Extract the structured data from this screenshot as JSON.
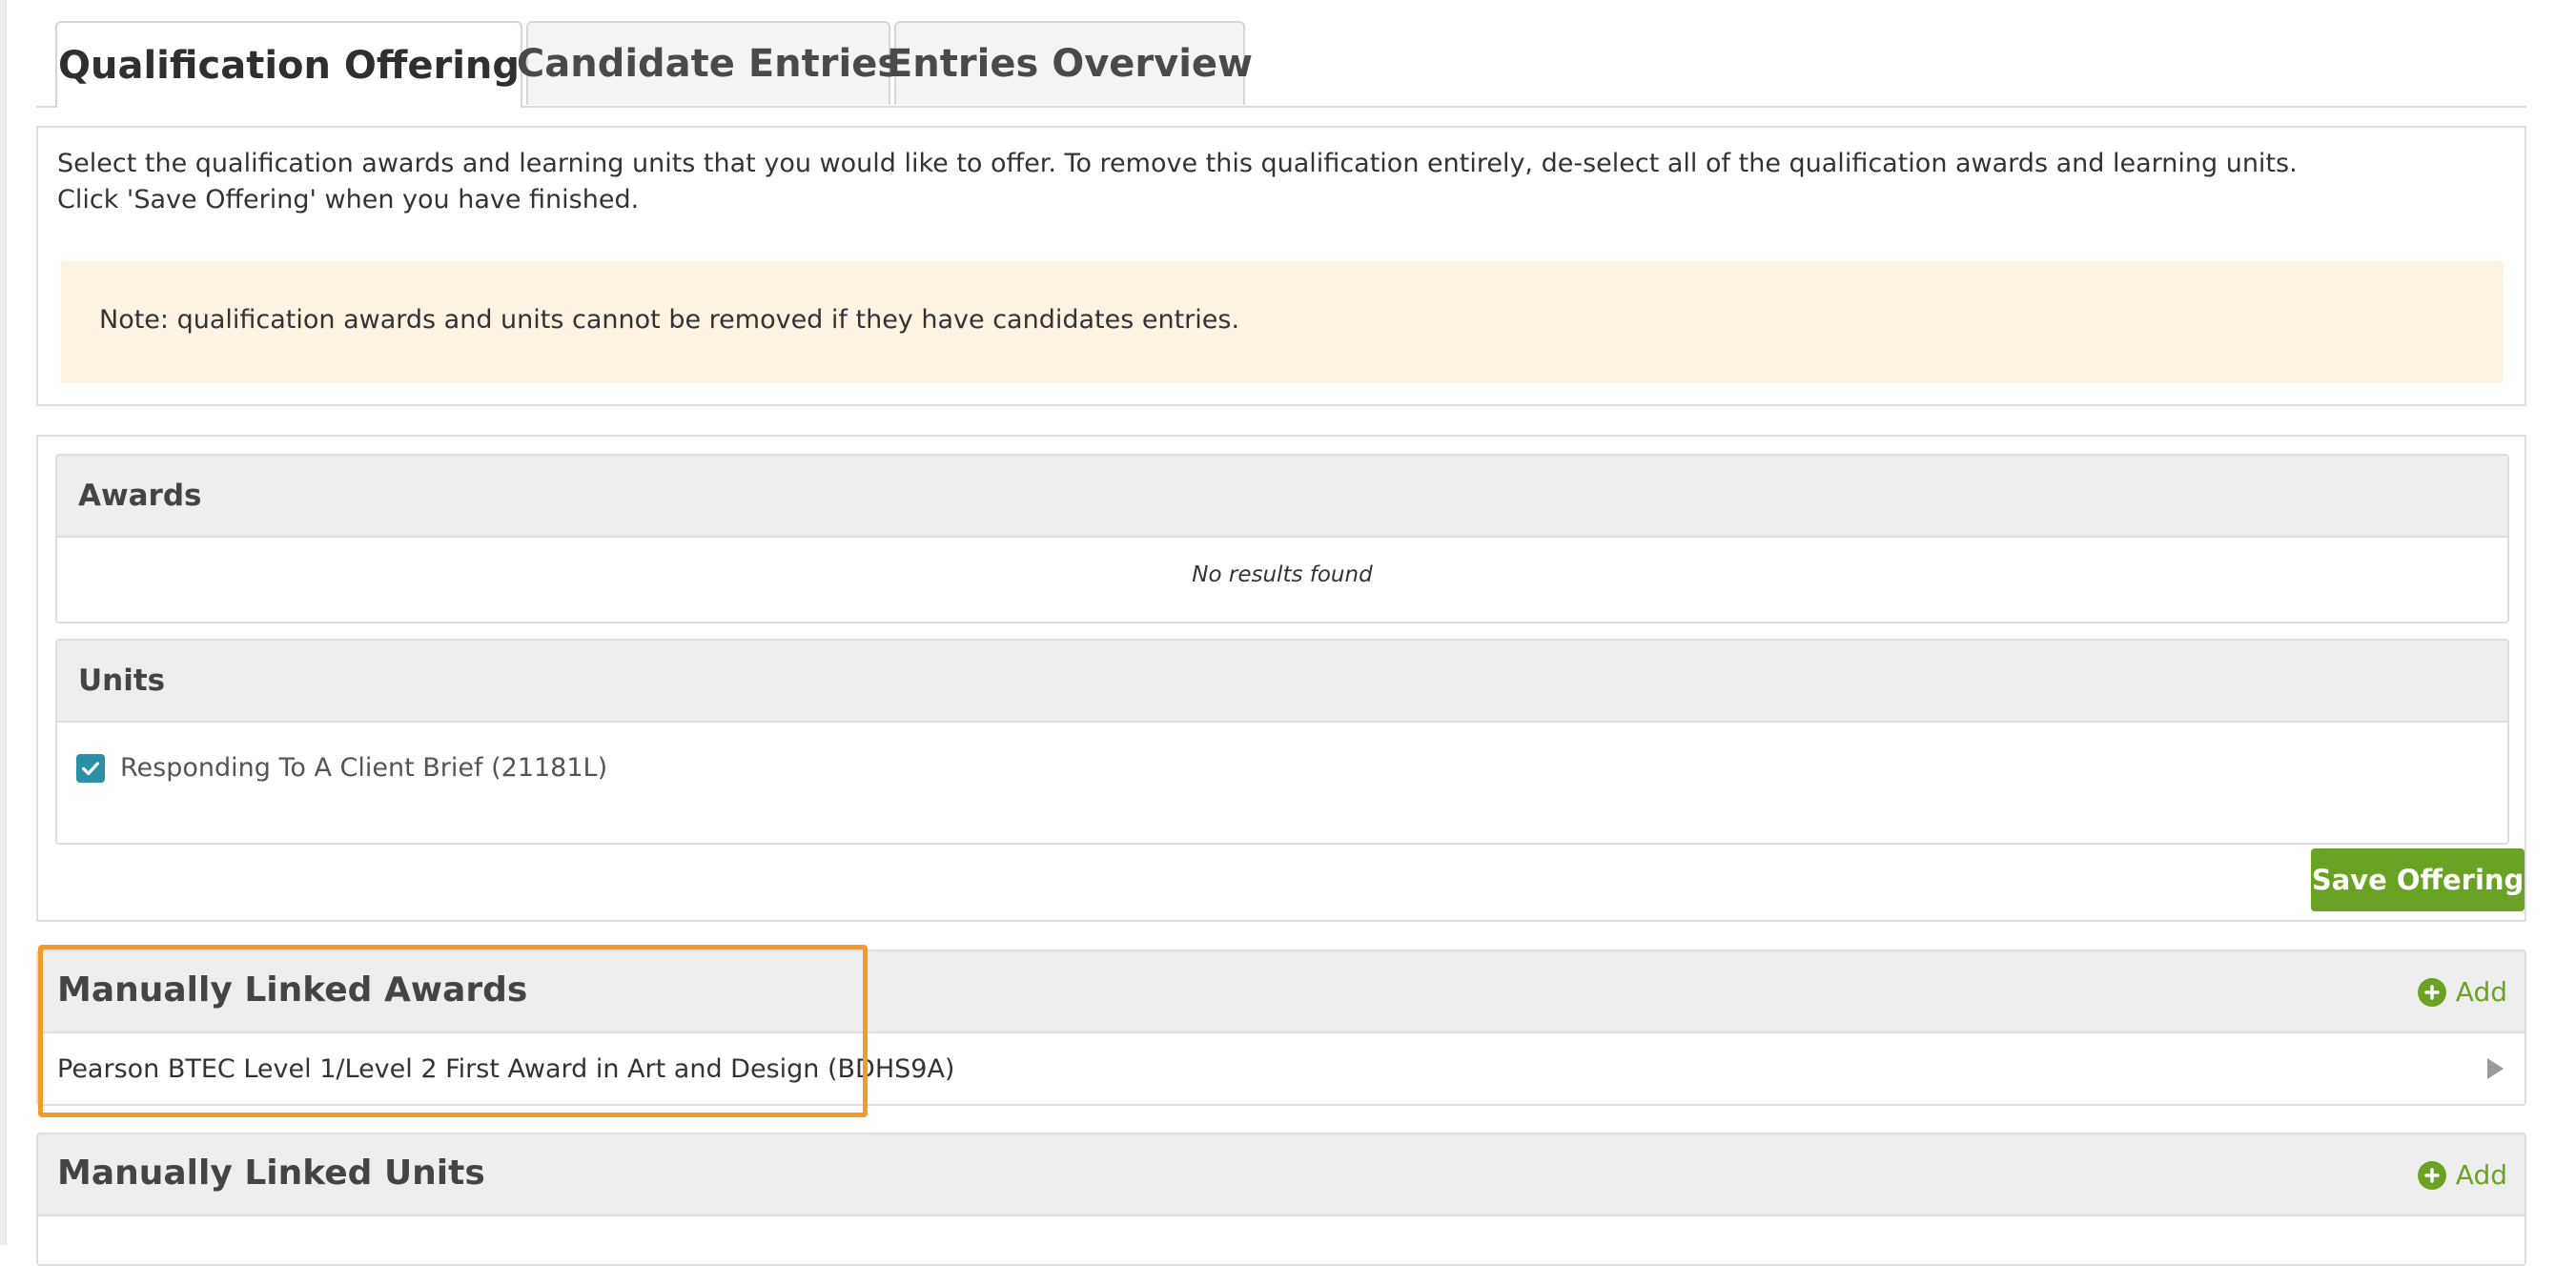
{
  "tabs": [
    {
      "label": "Qualification Offering",
      "active": true
    },
    {
      "label": "Candidate Entries",
      "active": false
    },
    {
      "label": "Entries Overview",
      "active": false
    }
  ],
  "intro": {
    "line1": "Select the qualification awards and learning units that you would like to offer. To remove this qualification entirely, de-select all of the qualification awards and learning units.",
    "line2": "Click 'Save Offering' when you have finished.",
    "note": "Note: qualification awards and units cannot be removed if they have candidates entries."
  },
  "awards_panel": {
    "title": "Awards",
    "empty_text": "No results found"
  },
  "units_panel": {
    "title": "Units",
    "items": [
      {
        "label": "Responding To A Client Brief (21181L)",
        "checked": true
      }
    ]
  },
  "save_button": "Save Offering",
  "manual_awards": {
    "title": "Manually Linked Awards",
    "add_label": "Add",
    "items": [
      {
        "label": "Pearson BTEC Level 1/Level 2 First Award in Art and Design (BDHS9A)"
      }
    ]
  },
  "manual_units": {
    "title": "Manually Linked Units",
    "add_label": "Add"
  },
  "colors": {
    "accent_green": "#6aa323",
    "checkbox_teal": "#2b8fa8",
    "note_background": "#fef2e2",
    "highlight_orange": "#f39a2a"
  },
  "icons": [
    "checkbox-checked-icon",
    "plus-circle-icon",
    "expand-arrow-icon"
  ]
}
